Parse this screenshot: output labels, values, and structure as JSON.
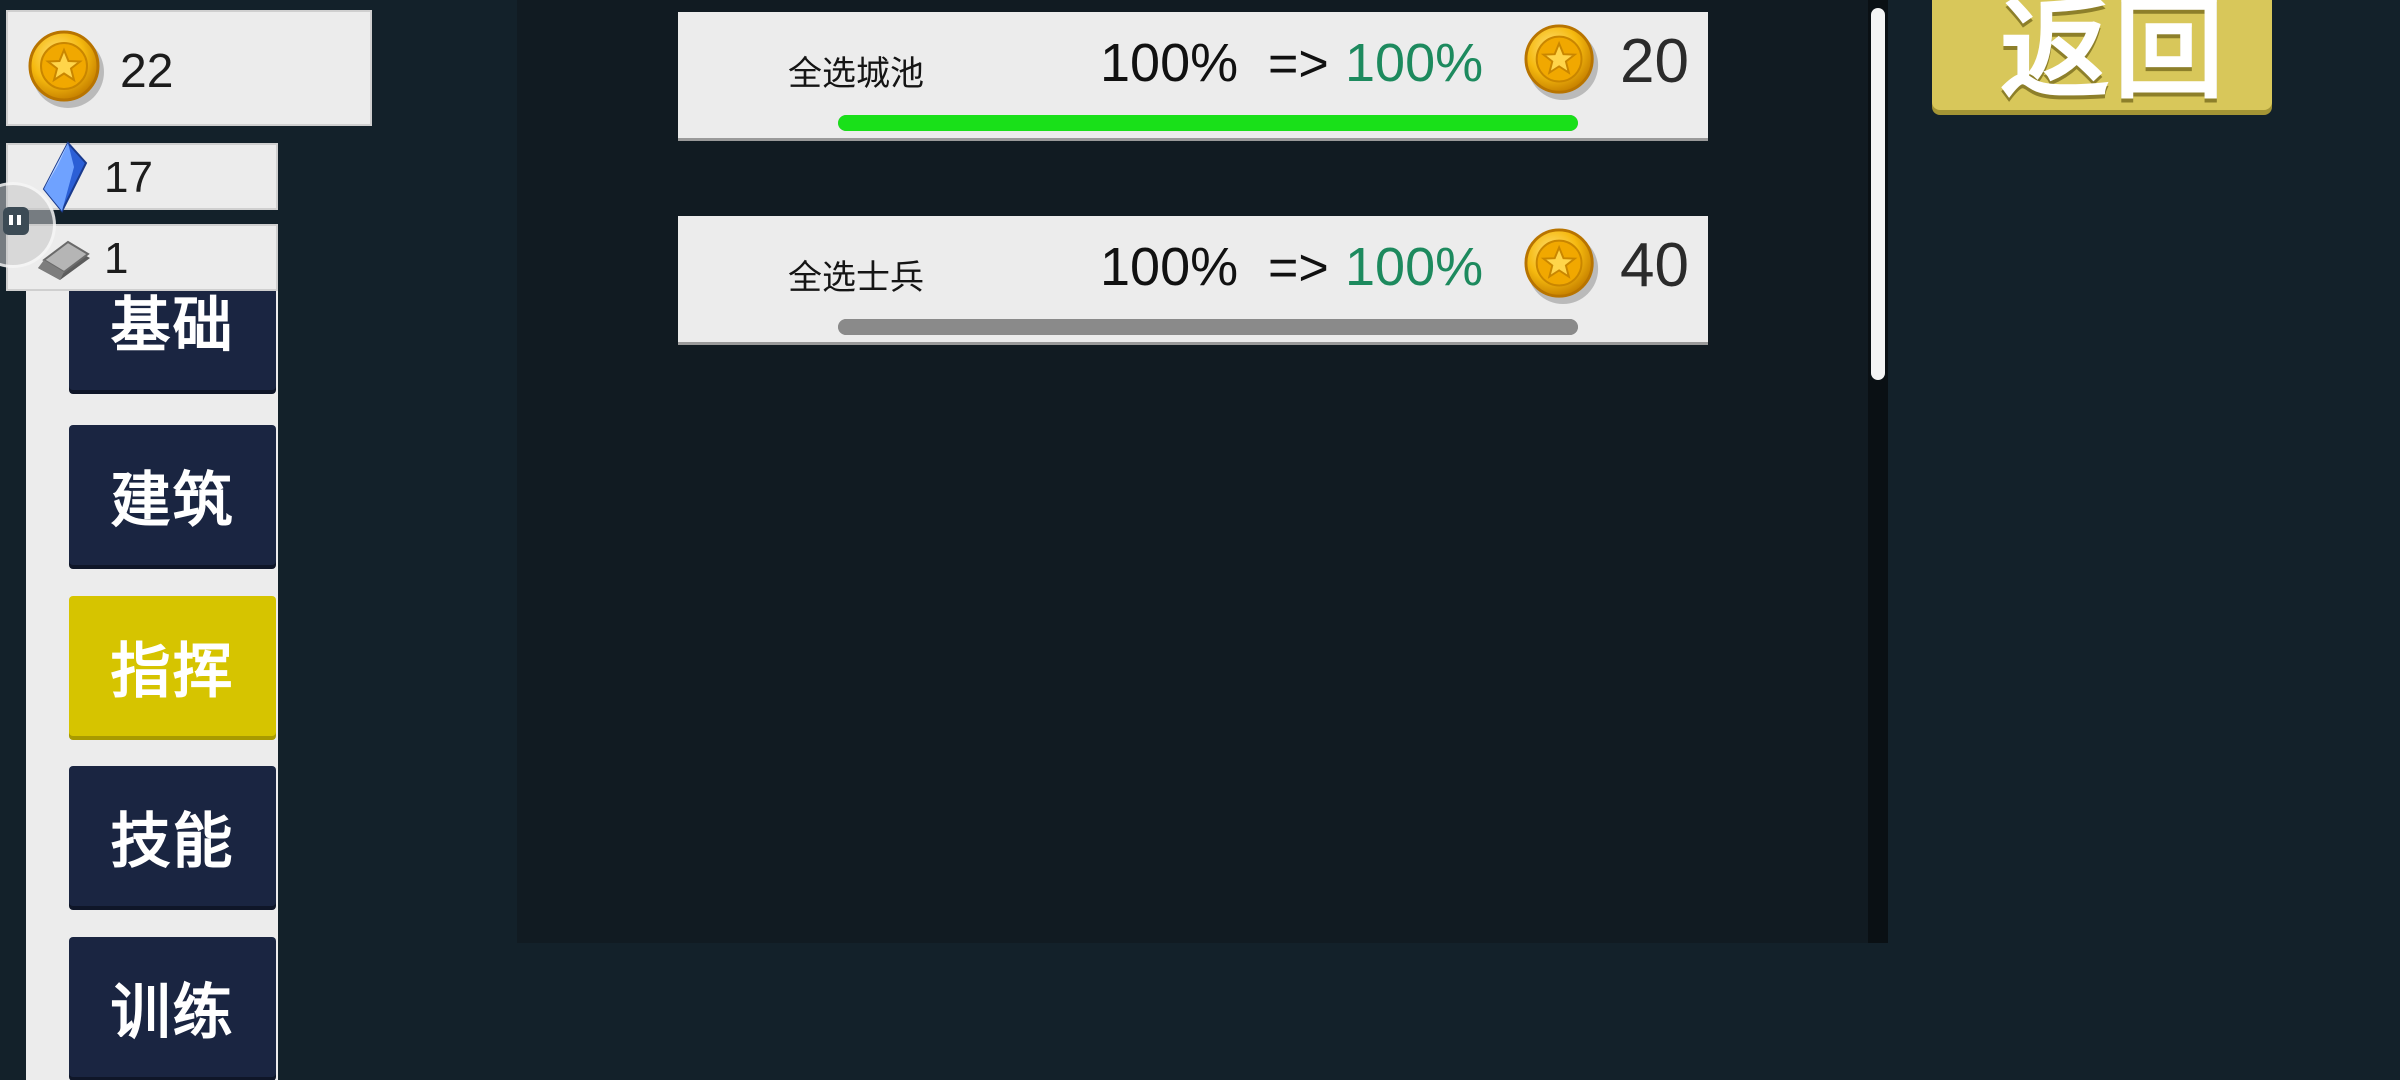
{
  "resources": {
    "gold": "22",
    "crystal": "17",
    "metal": "1"
  },
  "tabs": [
    {
      "label": "基础",
      "active": false
    },
    {
      "label": "建筑",
      "active": false
    },
    {
      "label": "指挥",
      "active": true
    },
    {
      "label": "技能",
      "active": false
    },
    {
      "label": "训练",
      "active": false
    }
  ],
  "upgrades": [
    {
      "label": "全选城池",
      "from": "100%",
      "arrow": "=>",
      "to": "100%",
      "cost": "20",
      "progress": 1.0,
      "bar_color": "#19e019"
    },
    {
      "label": "全选士兵",
      "from": "100%",
      "arrow": "=>",
      "to": "100%",
      "cost": "40",
      "progress": 1.0,
      "bar_color": "#8a8a8a"
    }
  ],
  "return_button": "返回",
  "colors": {
    "active_tab": "#d6c400",
    "tab": "#1a2541",
    "upgrade_target": "#1d8a5e"
  },
  "icons": [
    "gold-coin-icon",
    "crystal-icon",
    "metal-ingot-icon"
  ]
}
